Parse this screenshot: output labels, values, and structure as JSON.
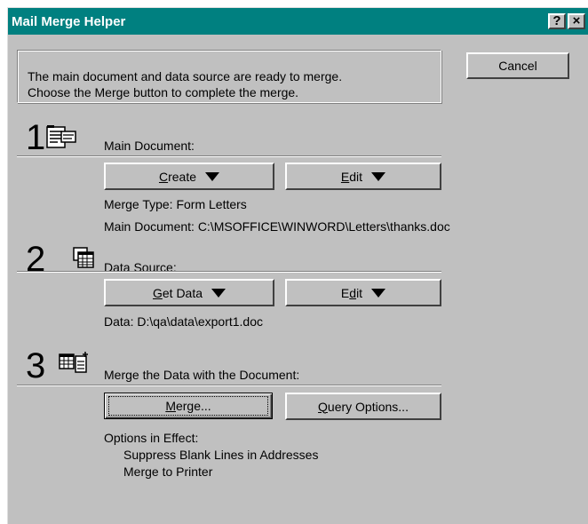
{
  "window": {
    "title": "Mail Merge Helper",
    "help_button": "?",
    "close_button": "×"
  },
  "message": {
    "line1": "The main document and data source are ready to merge.",
    "line2": "Choose the Merge button to complete the merge."
  },
  "cancel_label": "Cancel",
  "step1": {
    "number": "1",
    "heading": "Main Document:",
    "create_label": "Create",
    "create_access_key": "C",
    "create_rest": "reate",
    "edit_label": "Edit",
    "edit_access_key": "E",
    "edit_rest": "dit",
    "merge_type": "Merge Type: Form Letters",
    "main_document": "Main Document: C:\\MSOFFICE\\WINWORD\\Letters\\thanks.doc",
    "icon": "main-document-icon"
  },
  "step2": {
    "number": "2",
    "heading": "Data Source:",
    "get_data_label": "Get Data",
    "get_data_access_key": "G",
    "get_data_rest": "et Data",
    "edit_label": "Edit",
    "edit_pre": "E",
    "edit_access_key": "d",
    "edit_rest": "it",
    "data": "Data: D:\\qa\\data\\export1.doc",
    "icon": "data-source-icon"
  },
  "step3": {
    "number": "3",
    "heading": "Merge the Data with the Document:",
    "merge_label": "Merge...",
    "merge_access_key": "M",
    "merge_rest": "erge...",
    "query_label": "Query Options...",
    "query_access_key": "Q",
    "query_rest": "uery Options...",
    "options_title": "Options in Effect:",
    "options": [
      "Suppress Blank Lines in Addresses",
      "Merge to Printer"
    ],
    "icon": "merge-data-icon"
  },
  "colors": {
    "titlebar": "#008080",
    "face": "#c0c0c0",
    "highlight": "#ffffff",
    "shadow": "#808080"
  }
}
